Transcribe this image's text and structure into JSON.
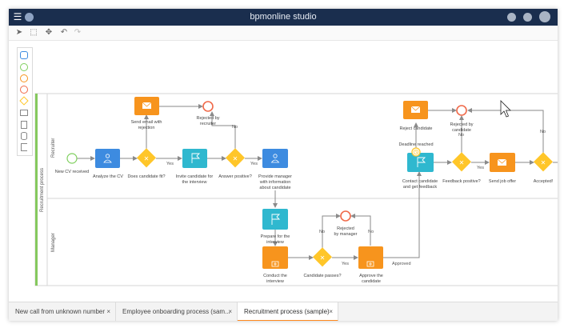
{
  "app": {
    "title": "bpmonline studio"
  },
  "toolbar": {
    "pointer": "pointer-icon",
    "select_area": "select-area-icon",
    "move": "move-icon",
    "undo": "undo-icon",
    "redo": "redo-icon"
  },
  "palette": {
    "items": [
      "task-icon",
      "start-event-icon",
      "intermediate-event-icon",
      "end-event-icon",
      "gateway-icon",
      "subprocess-icon",
      "document-icon",
      "database-icon",
      "annotation-icon"
    ]
  },
  "pool": {
    "name": "Recruitment process"
  },
  "lanes": {
    "recruiter": "Recruiter",
    "manager": "Manager"
  },
  "nodes": {
    "new_cv": "New CV received",
    "analyze_cv": "Analyze the CV",
    "candidate_fit": "Does candidate fit?",
    "send_rejection_1": "Send email with",
    "send_rejection_2": "rejection",
    "rejected_recruiter_1": "Rejected by",
    "rejected_recruiter_2": "recruiter",
    "invite_1": "Invite candidate for",
    "invite_2": "the interview",
    "answer_positive": "Answer positive?",
    "provide_1": "Provide manager",
    "provide_2": "with information",
    "provide_3": "about candidate",
    "reject_candidate": "Reject candidate",
    "rejected_candidate_1": "Rejected by",
    "rejected_candidate_2": "candidate",
    "deadline": "Deadline reached",
    "contact_1": "Contact candidate",
    "contact_2": "and get feedback",
    "feedback_positive": "Feedback positive?",
    "send_offer": "Send job offer",
    "accepted": "Accepted!",
    "prepare_1": "Prepare for the",
    "prepare_2": "interview",
    "conduct_1": "Conduct the",
    "conduct_2": "interview",
    "candidate_passes": "Candidate passes?",
    "rejected_manager_1": "Rejected",
    "rejected_manager_2": "by manager",
    "approve_1": "Approve the",
    "approve_2": "candidate"
  },
  "flow_labels": {
    "yes1": "Yes",
    "yes2": "Yes",
    "yes3": "Yes",
    "yes4": "Yes",
    "no1": "No",
    "no2": "No",
    "no3": "No",
    "no4": "No",
    "no5": "No",
    "approved": "Approved"
  },
  "tabs": [
    {
      "label": "New call from unknown number",
      "close": "×"
    },
    {
      "label": "Employee onboarding process (sam...",
      "close": "×"
    },
    {
      "label": "Recruitment process (sample)",
      "close": "×"
    }
  ],
  "colors": {
    "titlebar": "#1a2e4e",
    "task_blue": "#3d8be0",
    "task_teal": "#2fb8cf",
    "task_orange": "#f7941d",
    "gateway_yellow": "#ffc629",
    "start_green": "#7fcf5e",
    "end_red": "#f06a4a",
    "pool_accent": "#86c95e"
  }
}
